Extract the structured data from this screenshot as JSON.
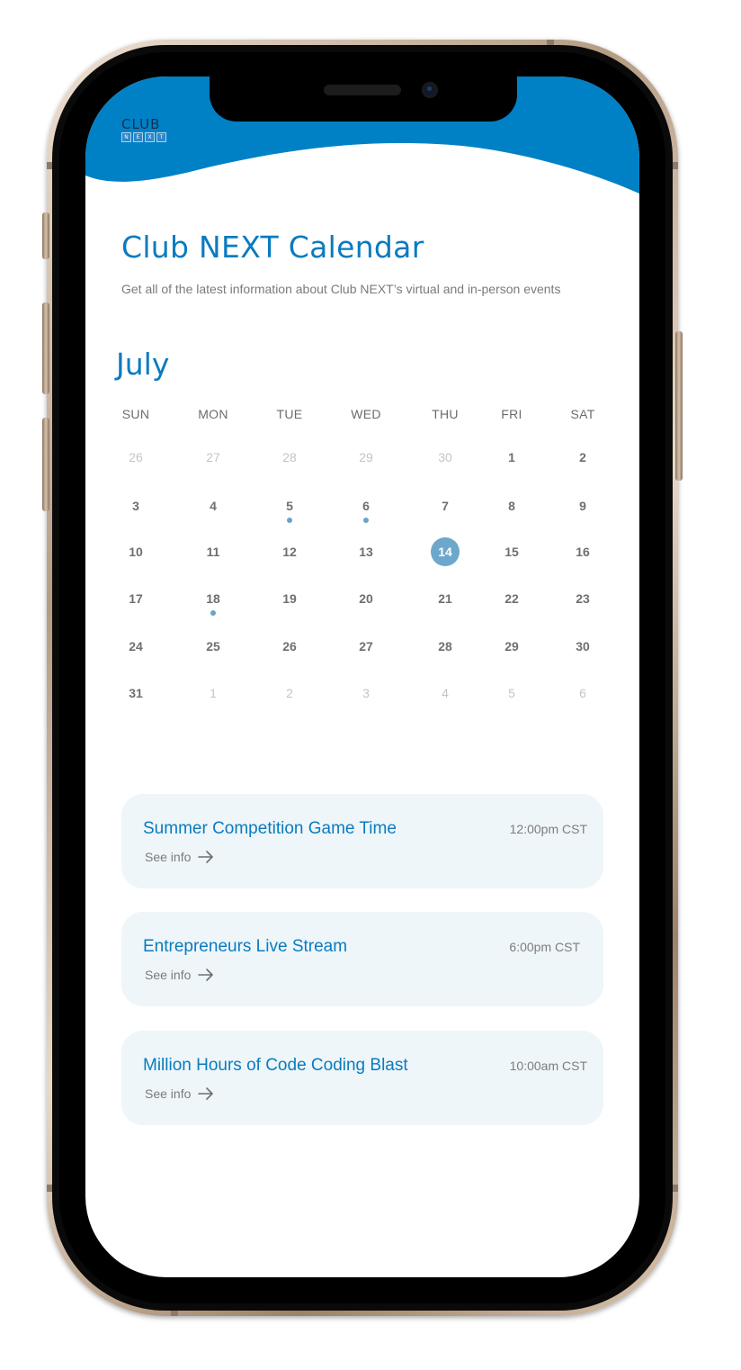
{
  "logo": {
    "text": "CLUB",
    "letters": [
      "N",
      "E",
      "X",
      "T"
    ]
  },
  "page": {
    "title": "Club NEXT Calendar",
    "subtitle": "Get all of the latest information about Club NEXT’s virtual and in-person events"
  },
  "calendar": {
    "month": "July",
    "weekdays": [
      "SUN",
      "MON",
      "TUE",
      "WED",
      "THU",
      "FRI",
      "SAT"
    ],
    "selected_day": "14",
    "weeks": [
      [
        "26",
        "27",
        "28",
        "29",
        "30",
        "1",
        "2"
      ],
      [
        "3",
        "4",
        "5",
        "6",
        "7",
        "8",
        "9"
      ],
      [
        "10",
        "11",
        "12",
        "13",
        "14",
        "15",
        "16"
      ],
      [
        "17",
        "18",
        "19",
        "20",
        "21",
        "22",
        "23"
      ],
      [
        "24",
        "25",
        "26",
        "27",
        "28",
        "29",
        "30"
      ],
      [
        "31",
        "1",
        "2",
        "3",
        "4",
        "5",
        "6"
      ]
    ],
    "event_days": [
      "5",
      "6",
      "18"
    ]
  },
  "events": [
    {
      "title": "Summer Competition Game Time",
      "time": "12:00pm CST",
      "link": "See info"
    },
    {
      "title": "Entrepreneurs Live Stream",
      "time": "6:00pm CST",
      "link": "See info"
    },
    {
      "title": "Million Hours of Code Coding Blast",
      "time": "10:00am CST",
      "link": "See info"
    }
  ],
  "colors": {
    "accent": "#0a7bc0",
    "header": "#0081c6",
    "card": "#eef6f9",
    "selected": "#6ea7cc"
  },
  "icons": {
    "event_link": "arrow-right-icon"
  }
}
